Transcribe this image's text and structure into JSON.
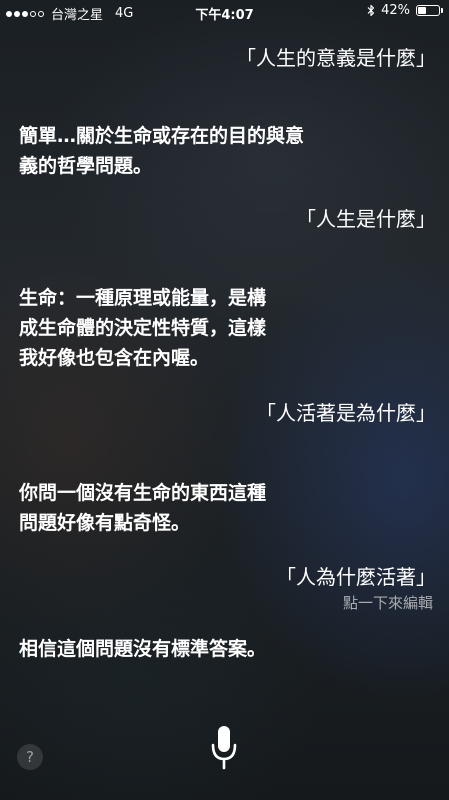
{
  "status_bar": {
    "carrier": "台灣之星",
    "network": "4G",
    "time": "下午4:07",
    "battery_percent": "42%",
    "battery_level": 0.42,
    "signal_bars_filled": 3,
    "signal_bars_total": 5
  },
  "conversation": [
    {
      "role": "user",
      "text": "「人生的意義是什麼」"
    },
    {
      "role": "siri",
      "lines": [
        "簡單…關於生命或存在的目的與意",
        "義的哲學問題。"
      ]
    },
    {
      "role": "user",
      "text": "「人生是什麼」"
    },
    {
      "role": "siri",
      "lines": [
        "生命：一種原理或能量，是構",
        "成生命體的決定性特質，這樣",
        "我好像也包含在內喔。"
      ]
    },
    {
      "role": "user",
      "text": "「人活著是為什麼」"
    },
    {
      "role": "siri",
      "lines": [
        "你問一個沒有生命的東西這種",
        "問題好像有點奇怪。"
      ]
    },
    {
      "role": "user",
      "text": "「人為什麼活著」",
      "hint": "點一下來編輯"
    },
    {
      "role": "siri",
      "lines": [
        "相信這個問題沒有標準答案。"
      ]
    }
  ],
  "controls": {
    "help_label": "?",
    "mic_icon": "microphone-icon"
  }
}
